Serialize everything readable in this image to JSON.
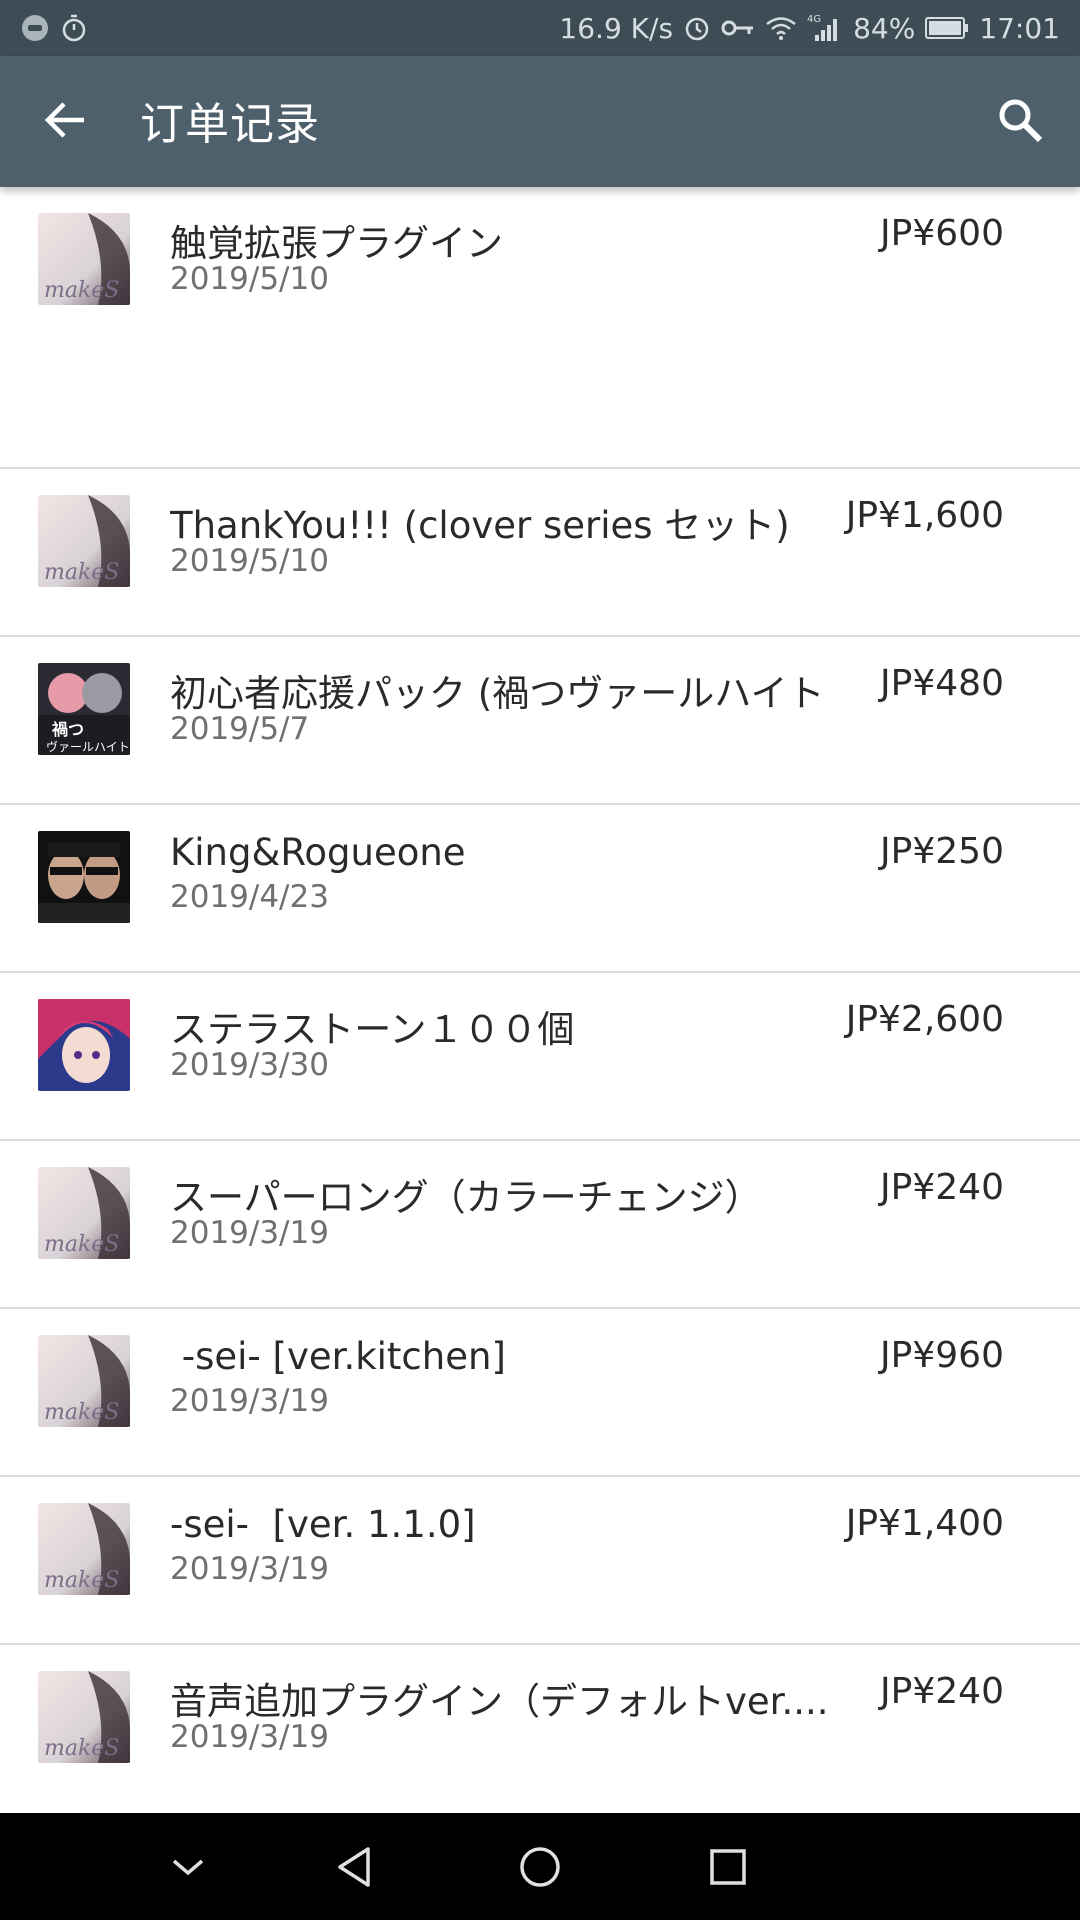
{
  "status_bar": {
    "net_speed": "16.9 K/s",
    "battery": "84%",
    "time": "17:01",
    "network_label": "4G",
    "icons": [
      "game-icon",
      "stopwatch-icon",
      "alarm-icon",
      "key-icon",
      "wifi-icon",
      "signal-icon",
      "battery-icon"
    ]
  },
  "app_bar": {
    "title": "订单记录",
    "back_icon": "arrow-left-icon",
    "search_icon": "search-icon",
    "color": "#4e606c"
  },
  "orders": [
    {
      "title": "触覚拡張プラグイン",
      "date": "2019/5/10",
      "price": "JP¥600",
      "thumb": "makes-logo"
    },
    {
      "title": "ThankYou!!! (clover series セット)",
      "date": "2019/5/10",
      "price": "JP¥1,600",
      "thumb": "makes-logo"
    },
    {
      "title": "初心者応援パック (禍つヴァールハイト",
      "date": "2019/5/7",
      "price": "JP¥480",
      "thumb": "valheit-art"
    },
    {
      "title": "King&Rogueone",
      "date": "2019/4/23",
      "price": "JP¥250",
      "thumb": "king-rogueone-art"
    },
    {
      "title": "ステラストーン１００個",
      "date": "2019/3/30",
      "price": "JP¥2,600",
      "thumb": "pink-hair-art"
    },
    {
      "title": "スーパーロング（カラーチェンジ）",
      "date": "2019/3/19",
      "price": "JP¥240",
      "thumb": "makes-logo"
    },
    {
      "title": " -sei- [ver.kitchen]",
      "date": "2019/3/19",
      "price": "JP¥960",
      "thumb": "makes-logo"
    },
    {
      "title": "-sei-  [ver. 1.1.0]",
      "date": "2019/3/19",
      "price": "JP¥1,400",
      "thumb": "makes-logo"
    },
    {
      "title": "音声追加プラグイン（デフォルトver....",
      "date": "2019/3/19",
      "price": "JP¥240",
      "thumb": "makes-logo"
    }
  ],
  "nav_bar": {
    "icons": [
      "chevron-down-icon",
      "back-triangle-icon",
      "home-circle-icon",
      "recents-square-icon"
    ]
  }
}
